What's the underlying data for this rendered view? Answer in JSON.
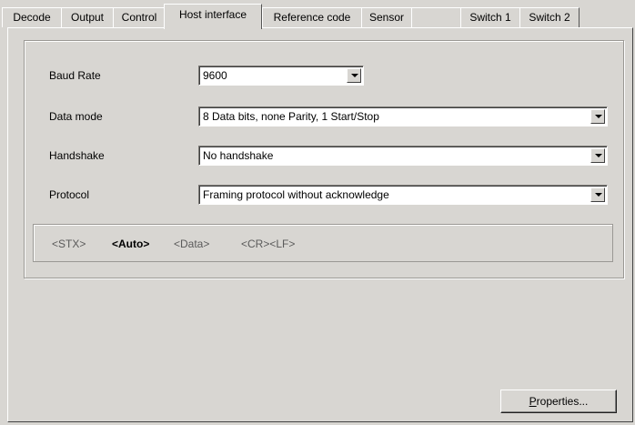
{
  "tabs": [
    {
      "label": "Decode"
    },
    {
      "label": "Output"
    },
    {
      "label": "Control"
    },
    {
      "label": "Host interface",
      "active": true
    },
    {
      "label": "Reference code"
    },
    {
      "label": "Sensor"
    },
    {
      "label": ""
    },
    {
      "label": "Switch 1"
    },
    {
      "label": "Switch 2"
    }
  ],
  "form": {
    "baud_rate": {
      "label": "Baud Rate",
      "value": "9600"
    },
    "data_mode": {
      "label": "Data mode",
      "value": "8 Data bits, none Parity, 1 Start/Stop"
    },
    "handshake": {
      "label": "Handshake",
      "value": "No handshake"
    },
    "protocol": {
      "label": "Protocol",
      "value": "Framing protocol without acknowledge"
    }
  },
  "protocol_format": {
    "stx": "<STX>",
    "auto": "<Auto>",
    "data": "<Data>",
    "crlf": "<CR><LF>"
  },
  "buttons": {
    "properties_accel": "P",
    "properties_rest": "roperties..."
  }
}
